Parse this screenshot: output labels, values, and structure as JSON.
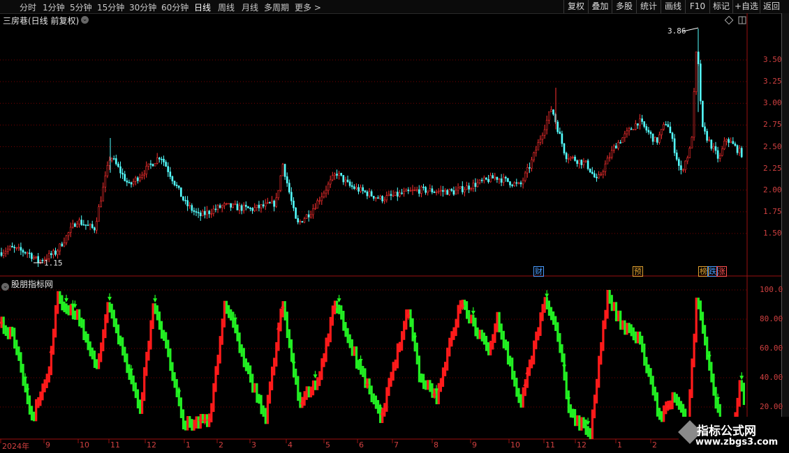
{
  "toolbar": {
    "periods": [
      "分时",
      "1分钟",
      "5分钟",
      "15分钟",
      "30分钟",
      "60分钟",
      "日线",
      "周线",
      "月线",
      "多周期",
      "更多 >"
    ],
    "active_period": "日线",
    "buttons": [
      "复权",
      "叠加",
      "多股",
      "统计",
      "画线",
      "F10",
      "标记",
      "+自选",
      "返回"
    ]
  },
  "main_chart": {
    "title": "三房巷(日线 前复权)",
    "y_ticks": [
      "3.50",
      "3.25",
      "3.00",
      "2.75",
      "2.50",
      "2.25",
      "2.00",
      "1.75",
      "1.50"
    ],
    "high_label": "3.86",
    "low_label": "1.15",
    "events": [
      {
        "text": "财",
        "color": "#4a9cff"
      },
      {
        "text": "预",
        "color": "#e0a030"
      },
      {
        "text": "榜",
        "color": "#e0a030"
      },
      {
        "text": "跌",
        "color": "#4a9cff"
      },
      {
        "text": "涨",
        "color": "#ff5050"
      }
    ]
  },
  "indicator": {
    "title": "股朋指标网",
    "y_ticks": [
      "100.0",
      "80.00",
      "60.00",
      "40.00",
      "20.00"
    ]
  },
  "x_axis": {
    "labels": [
      "2024年",
      "9",
      "10",
      "11",
      "12",
      "1",
      "2",
      "3",
      "4",
      "5",
      "6",
      "7",
      "8",
      "9",
      "10",
      "11",
      "12",
      "1",
      "2"
    ]
  },
  "watermark": {
    "line1": "指标公式网",
    "line2": "www.zbgs3.com"
  },
  "colors": {
    "up": "#ff3030",
    "down": "#54ffff",
    "grid": "#8b0000",
    "ind_up": "#ff1a1a",
    "ind_down": "#22ee22"
  }
}
